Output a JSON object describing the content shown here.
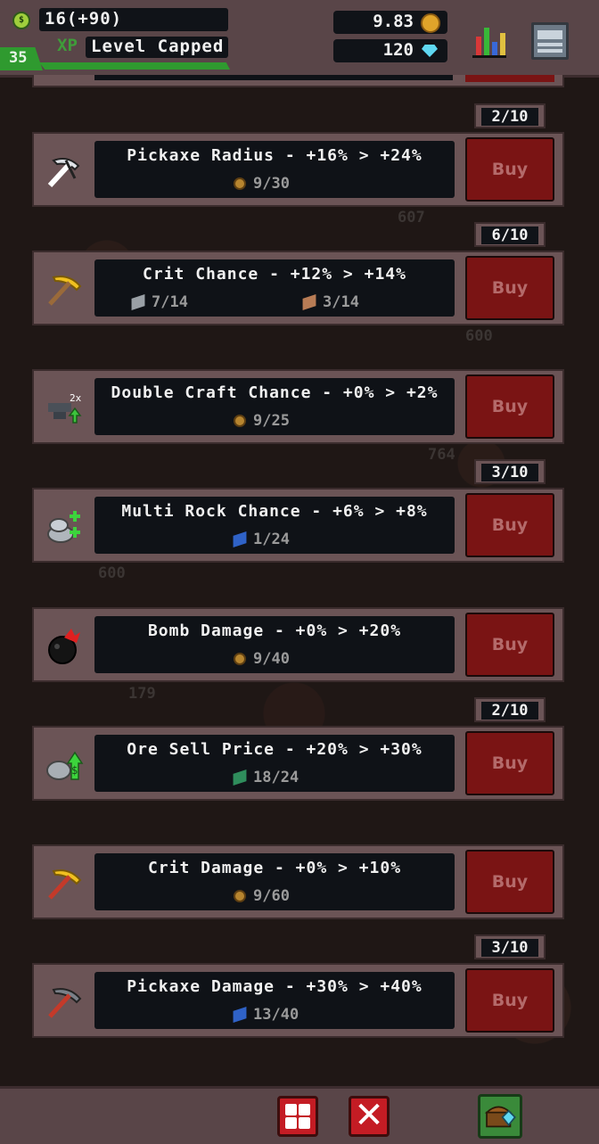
{
  "hud": {
    "gold": "16(+90)",
    "xp_label": "XP",
    "xp_status": "Level Capped",
    "level": "35",
    "coins": "9.83",
    "gems": "120"
  },
  "background_numbers": [
    "607",
    "600",
    "764",
    "600",
    "179"
  ],
  "upgrades": [
    {
      "name": "Pickaxe Radius - +16% > +24%",
      "level": "2/10",
      "costs": [
        {
          "type": "coin",
          "amount": "9/30"
        }
      ],
      "button": "Buy",
      "icon": "pickaxe-radius-icon"
    },
    {
      "name": "Crit Chance - +12% > +14%",
      "level": "6/10",
      "costs": [
        {
          "type": "gray-ore",
          "amount": "7/14"
        },
        {
          "type": "brown-ore",
          "amount": "3/14"
        }
      ],
      "button": "Buy",
      "icon": "gold-pickaxe-icon"
    },
    {
      "name": "Double Craft Chance - +0% > +2%",
      "level": "",
      "costs": [
        {
          "type": "coin",
          "amount": "9/25"
        }
      ],
      "button": "Buy",
      "icon": "double-craft-icon"
    },
    {
      "name": "Multi Rock Chance - +6% > +8%",
      "level": "3/10",
      "costs": [
        {
          "type": "blue-ore",
          "amount": "1/24"
        }
      ],
      "button": "Buy",
      "icon": "multi-rock-icon"
    },
    {
      "name": "Bomb Damage - +0% > +20%",
      "level": "",
      "costs": [
        {
          "type": "coin",
          "amount": "9/40"
        }
      ],
      "button": "Buy",
      "icon": "bomb-icon"
    },
    {
      "name": "Ore Sell Price - +20% > +30%",
      "level": "2/10",
      "costs": [
        {
          "type": "green-ore",
          "amount": "18/24"
        }
      ],
      "button": "Buy",
      "icon": "ore-sell-icon"
    },
    {
      "name": "Crit Damage - +0% > +10%",
      "level": "",
      "costs": [
        {
          "type": "coin",
          "amount": "9/60"
        }
      ],
      "button": "Buy",
      "icon": "crit-damage-pickaxe-icon"
    },
    {
      "name": "Pickaxe Damage - +30% > +40%",
      "level": "3/10",
      "costs": [
        {
          "type": "blue-ore",
          "amount": "13/40"
        }
      ],
      "button": "Buy",
      "icon": "pickaxe-damage-icon"
    }
  ],
  "colors": {
    "buy_button": "#7a1414",
    "card": "#6b5456",
    "panel": "#0f1217",
    "xp_green": "#2f9a2f"
  }
}
